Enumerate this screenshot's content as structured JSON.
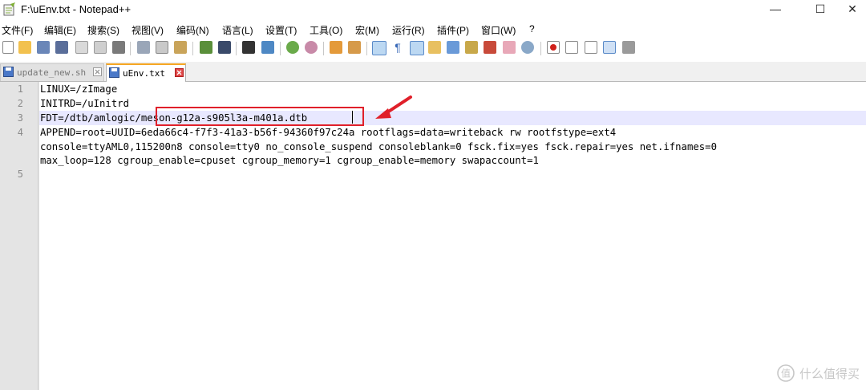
{
  "window": {
    "title": "F:\\uEnv.txt - Notepad++",
    "minimize": "—",
    "maximize": "☐",
    "close": "✕"
  },
  "menu": [
    "文件(F)",
    "编辑(E)",
    "搜索(S)",
    "视图(V)",
    "编码(N)",
    "语言(L)",
    "设置(T)",
    "工具(O)",
    "宏(M)",
    "运行(R)",
    "插件(P)",
    "窗口(W)",
    "?"
  ],
  "tabs": [
    {
      "label": "update_new.sh",
      "active": false
    },
    {
      "label": "uEnv.txt",
      "active": true
    }
  ],
  "editor": {
    "line_numbers": [
      "1",
      "2",
      "3",
      "4",
      "5"
    ],
    "lines": [
      "LINUX=/zImage",
      "INITRD=/uInitrd",
      "FDT=/dtb/amlogic/meson-g12a-s905l3a-m401a.dtb",
      "APPEND=root=UUID=6eda66c4-f7f3-41a3-b56f-94360f97c24a rootflags=data=writeback rw rootfstype=ext4",
      "console=ttyAML0,115200n8 console=tty0 no_console_suspend consoleblank=0 fsck.fix=yes fsck.repair=yes net.ifnames=0",
      "max_loop=128 cgroup_enable=cpuset cgroup_memory=1 cgroup_enable=memory swapaccount=1"
    ]
  },
  "watermark": "什么值得买",
  "colors": {
    "annotation_red": "#e0202a",
    "current_line": "#e8e8ff",
    "active_tab_accent": "#f5a623"
  }
}
